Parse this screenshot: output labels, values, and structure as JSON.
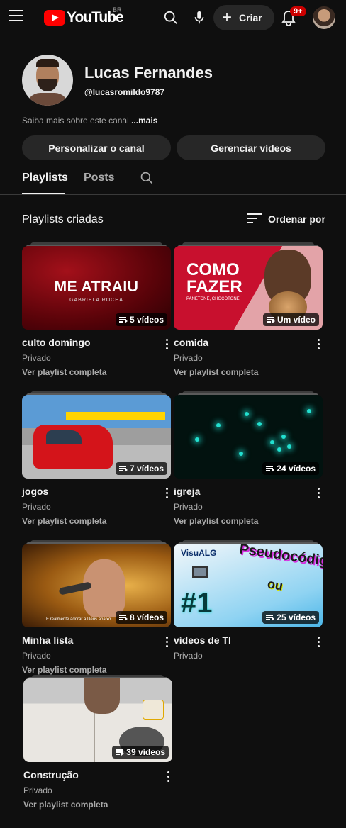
{
  "header": {
    "logo_text": "YouTube",
    "logo_country": "BR",
    "create_label": "Criar",
    "notifications": "9+"
  },
  "channel": {
    "name": "Lucas Fernandes",
    "handle": "@lucasromildo9787",
    "about_prefix": "Saiba mais sobre este canal ",
    "about_more": "...mais",
    "customize_label": "Personalizar o canal",
    "manage_label": "Gerenciar vídeos"
  },
  "tabs": [
    {
      "label": "Playlists",
      "active": true
    },
    {
      "label": "Posts",
      "active": false
    }
  ],
  "section": {
    "title": "Playlists criadas",
    "sort_label": "Ordenar por"
  },
  "playlists": [
    {
      "title": "culto domingo",
      "count": "5 vídeos",
      "privacy": "Privado",
      "link": "Ver playlist completa",
      "thumb_text": "ME ATRAIU",
      "thumb_sub": "GABRIELA ROCHA"
    },
    {
      "title": "comida",
      "count": "Um vídeo",
      "privacy": "Privado",
      "link": "Ver playlist completa",
      "thumb_text": "COMO FAZER",
      "thumb_sub": "PANETONE, CHOCOTONE."
    },
    {
      "title": "jogos",
      "count": "7 vídeos",
      "privacy": "Privado",
      "link": "Ver playlist completa"
    },
    {
      "title": "igreja",
      "count": "24 vídeos",
      "privacy": "Privado",
      "link": "Ver playlist completa"
    },
    {
      "title": "Minha lista",
      "count": "8 vídeos",
      "privacy": "Privado",
      "link": "Ver playlist completa",
      "thumb_caption": "E realmente adorar a Deus apaixo"
    },
    {
      "title": "vídeos de TI",
      "count": "25 vídeos",
      "privacy": "Privado",
      "thumb_v": "VisuALG",
      "thumb_num": "#1",
      "thumb_pseudo": "Pseudocódigo",
      "thumb_ou": "ou"
    },
    {
      "title": "Construção",
      "count": "39 vídeos",
      "privacy": "Privado",
      "link": "Ver playlist completa"
    }
  ]
}
